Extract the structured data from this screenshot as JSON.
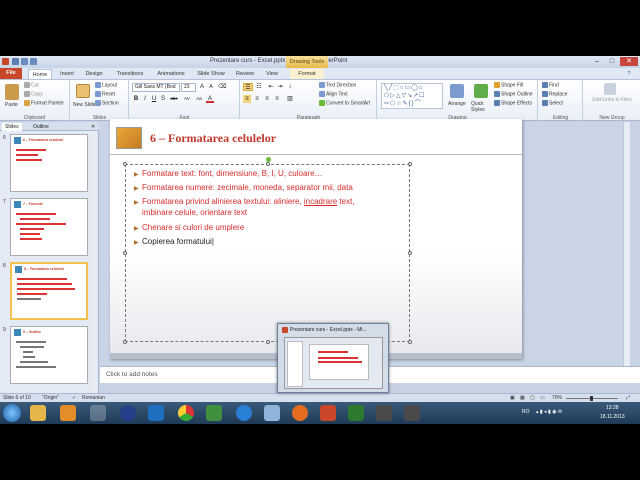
{
  "titlebar": {
    "title": "Prezentare curs - Excel.pptx - Microsoft PowerPoint",
    "drawing_tools": "Drawing Tools"
  },
  "tabs": [
    "File",
    "Home",
    "Insert",
    "Design",
    "Transitions",
    "Animations",
    "Slide Show",
    "Review",
    "View",
    "Format"
  ],
  "ribbon": {
    "clipboard": {
      "label": "Clipboard",
      "paste": "Paste",
      "cut": "Cut",
      "copy": "Copy",
      "format_painter": "Format Painter"
    },
    "slides": {
      "label": "Slides",
      "new_slide": "New Slide",
      "layout": "Layout",
      "reset": "Reset",
      "section": "Section"
    },
    "font": {
      "label": "Font",
      "font_name": "Gill Sans MT (Bod",
      "font_size": "23",
      "buttons": [
        "B",
        "I",
        "U",
        "S",
        "abc",
        "AV",
        "Aa",
        "A"
      ]
    },
    "paragraph": {
      "label": "Paragraph",
      "text_direction": "Text Direction",
      "align_text": "Align Text",
      "convert_smartart": "Convert to SmartArt"
    },
    "drawing": {
      "label": "Drawing",
      "arrange": "Arrange",
      "quick_styles": "Quick Styles",
      "shape_fill": "Shape Fill",
      "shape_outline": "Shape Outline",
      "shape_effects": "Shape Effects"
    },
    "editing": {
      "label": "Editing",
      "find": "Find",
      "replace": "Replace",
      "select": "Select"
    },
    "new_group": {
      "label": "New Group",
      "edit_links": "Edit Links to Files"
    }
  },
  "pane": {
    "tab_slides": "Slides",
    "tab_outline": "Outline",
    "thumbs": [
      {
        "num": "6",
        "title": "6 – Formatarea celulelor"
      },
      {
        "num": "7",
        "title": "7 – Formule"
      },
      {
        "num": "8",
        "title": "8 – Formatarea celulelor"
      },
      {
        "num": "9",
        "title": "9 – Grafice"
      }
    ]
  },
  "slide": {
    "title": "6 – Formatarea celulelor",
    "bullets": [
      {
        "text": "Formatare text: font, dimensiune, B, I, U, culoare…"
      },
      {
        "text": "Formatarea numere: zecimale, moneda, separator mii, data"
      },
      {
        "text_a": "Formatarea privind alinierea textului: aliniere, ",
        "text_b": "incadrare",
        "text_c": " text,",
        "text_d": "imbinare celule, orientare text"
      },
      {
        "text": "Chenare si culori de umplere"
      },
      {
        "text": "Copierea formatului"
      }
    ]
  },
  "notes": {
    "placeholder": "Click to add notes"
  },
  "status": {
    "slide": "Slide 6 of 10",
    "theme": "\"Origin\"",
    "language": "Romanian",
    "zoom": "70%"
  },
  "preview": {
    "title": "Prezentare curs - Excel.pptx - Mi..."
  },
  "taskbar": {
    "lang": "RO",
    "time": "13:28",
    "date": "18.11.2013"
  }
}
